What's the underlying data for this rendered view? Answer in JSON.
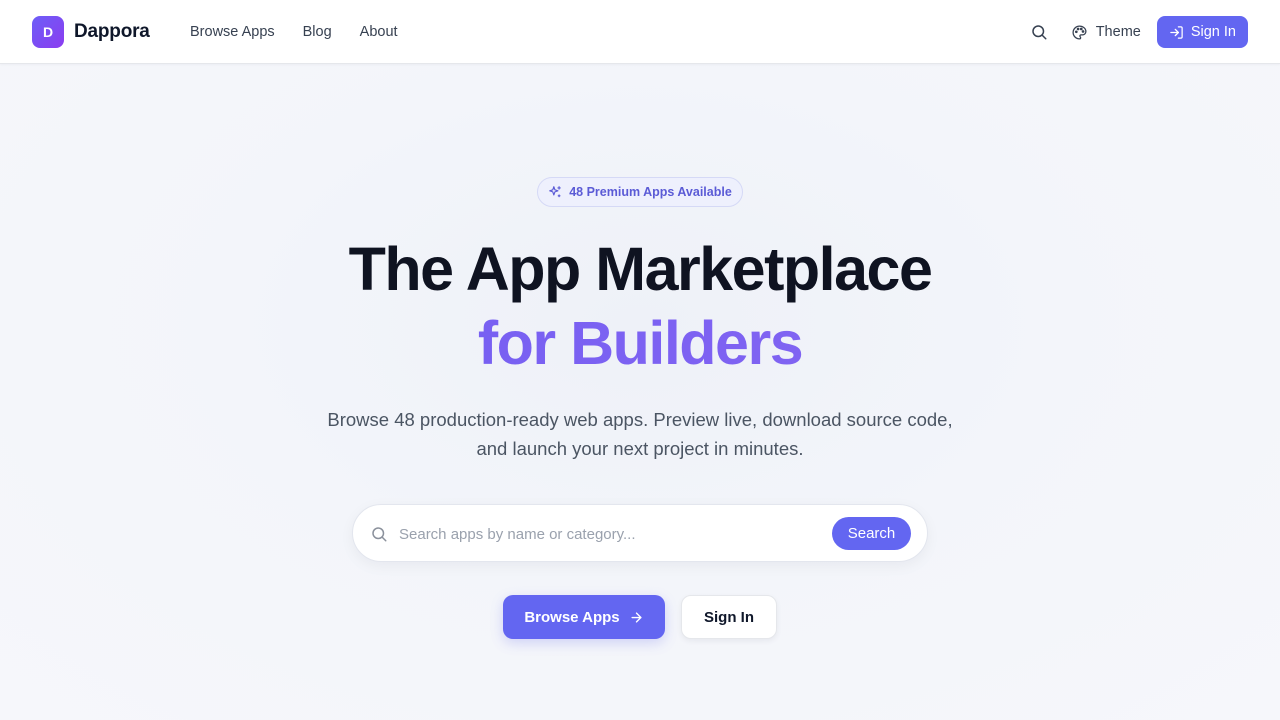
{
  "header": {
    "logo_letter": "D",
    "brand": "Dappora",
    "nav": [
      "Browse Apps",
      "Blog",
      "About"
    ],
    "theme_label": "Theme",
    "signin_label": "Sign In",
    "icons": [
      "search-icon",
      "palette-icon",
      "sign-in-icon"
    ]
  },
  "hero": {
    "badge": "48 Premium Apps Available",
    "badge_icon": "sparkles-icon",
    "title_line1": "The App Marketplace",
    "title_line2": "for Builders",
    "subtitle_line1": "Browse 48 production-ready web apps. Preview live, download source code,",
    "subtitle_line2": "and launch your next project in minutes."
  },
  "search": {
    "placeholder": "Search apps by name or category...",
    "value": "",
    "button_label": "Search"
  },
  "cta": {
    "primary_label": "Browse Apps",
    "primary_icon": "arrow-right-icon",
    "secondary_label": "Sign In"
  },
  "colors": {
    "accent": "#6366f1",
    "gradient_start": "#6d5cf2",
    "gradient_end": "#8b6cf3",
    "title": "#0f1321",
    "text_muted": "#4b5563"
  }
}
